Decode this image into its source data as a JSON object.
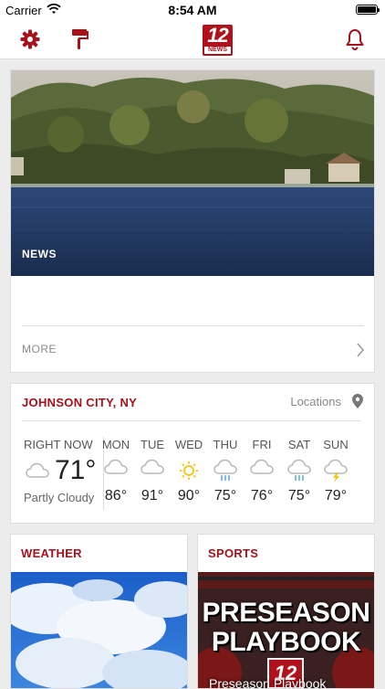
{
  "status_bar": {
    "carrier": "Carrier",
    "time": "8:54 AM"
  },
  "nav": {
    "logo_number": "12",
    "logo_label": "NEWS"
  },
  "news": {
    "tag": "NEWS",
    "more_label": "MORE"
  },
  "weather": {
    "location": "JOHNSON CITY, NY",
    "locations_label": "Locations",
    "right_now": {
      "label": "RIGHT NOW",
      "temp": "71°",
      "condition": "Partly Cloudy",
      "icon": "cloud-icon"
    },
    "forecast": [
      {
        "day": "MON",
        "temp": "86°",
        "icon": "cloud-icon"
      },
      {
        "day": "TUE",
        "temp": "91°",
        "icon": "cloud-icon"
      },
      {
        "day": "WED",
        "temp": "90°",
        "icon": "sun-icon"
      },
      {
        "day": "THU",
        "temp": "75°",
        "icon": "rain-icon"
      },
      {
        "day": "FRI",
        "temp": "76°",
        "icon": "cloud-icon"
      },
      {
        "day": "SAT",
        "temp": "75°",
        "icon": "rain-icon"
      },
      {
        "day": "SUN",
        "temp": "79°",
        "icon": "thunderstorm-icon"
      }
    ]
  },
  "tiles": {
    "weather_title": "WEATHER",
    "sports_title": "SPORTS",
    "sports_promo_line1": "PRESEASON",
    "sports_promo_line2": "PLAYBOOK",
    "sports_promo_badge": "12",
    "sports_caption": "Preseason Playbook"
  },
  "colors": {
    "brand_red": "#a5121c",
    "icon_gray": "#b8b8b8",
    "sun_yellow": "#f3c316",
    "rain_blue": "#5aa9d6"
  }
}
